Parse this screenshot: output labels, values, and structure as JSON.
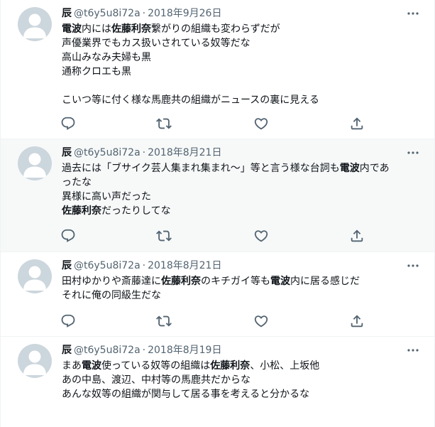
{
  "tweets": [
    {
      "name": "辰",
      "handle": "@t6y5u8i72a",
      "separator": "·",
      "date": "2018年9月26日",
      "lines": [
        [
          {
            "t": "電波",
            "b": true
          },
          {
            "t": "内には",
            "b": false
          },
          {
            "t": "佐藤利奈",
            "b": true
          },
          {
            "t": "繋がりの組織も変わらずだが",
            "b": false
          }
        ],
        [
          {
            "t": "声優業界でもカス扱いされている奴等だな",
            "b": false
          }
        ],
        [
          {
            "t": "高山みなみ夫婦も黒",
            "b": false
          }
        ],
        [
          {
            "t": "通称クロエも黒",
            "b": false
          }
        ],
        [],
        [
          {
            "t": "こいつ等に付く様な馬鹿共の組織がニュースの裏に見える",
            "b": false
          }
        ]
      ]
    },
    {
      "name": "辰",
      "handle": "@t6y5u8i72a",
      "separator": "·",
      "date": "2018年8月21日",
      "lines": [
        [
          {
            "t": "過去には「ブサイク芸人集まれ集まれ〜」等と言う様な台詞も",
            "b": false
          },
          {
            "t": "電波",
            "b": true
          },
          {
            "t": "内であ",
            "b": false
          }
        ],
        [
          {
            "t": "ったな",
            "b": false
          }
        ],
        [
          {
            "t": "異様に高い声だった",
            "b": false
          }
        ],
        [
          {
            "t": "佐藤利奈",
            "b": true
          },
          {
            "t": "だったりしてな",
            "b": false
          }
        ]
      ]
    },
    {
      "name": "辰",
      "handle": "@t6y5u8i72a",
      "separator": "·",
      "date": "2018年8月21日",
      "lines": [
        [
          {
            "t": "田村ゆかりや斎藤達に",
            "b": false
          },
          {
            "t": "佐藤利奈",
            "b": true
          },
          {
            "t": "のキチガイ等も",
            "b": false
          },
          {
            "t": "電波",
            "b": true
          },
          {
            "t": "内に居る感じだ",
            "b": false
          }
        ],
        [
          {
            "t": "それに俺の同級生だな",
            "b": false
          }
        ]
      ]
    },
    {
      "name": "辰",
      "handle": "@t6y5u8i72a",
      "separator": "·",
      "date": "2018年8月19日",
      "lines": [
        [
          {
            "t": "まあ",
            "b": false
          },
          {
            "t": "電波",
            "b": true
          },
          {
            "t": "使っている奴等の組織は",
            "b": false
          },
          {
            "t": "佐藤利奈",
            "b": true
          },
          {
            "t": "、小松、上坂他",
            "b": false
          }
        ],
        [
          {
            "t": "あの中島、渡辺、中村等の馬鹿共だからな",
            "b": false
          }
        ],
        [
          {
            "t": "あんな奴等の組織が関与して居る事を考えると分かるな",
            "b": false
          }
        ]
      ]
    }
  ],
  "icons": {
    "more": "more-horizontal-icon",
    "reply": "reply-icon",
    "retweet": "retweet-icon",
    "like": "like-heart-icon",
    "share": "share-icon"
  },
  "colors": {
    "text": "#0f1419",
    "muted": "#536471",
    "border": "#eff3f4",
    "highlight_bg": "#f7f9f9",
    "avatar_bg": "#ccd6dd",
    "avatar_fg": "#ffffff"
  }
}
